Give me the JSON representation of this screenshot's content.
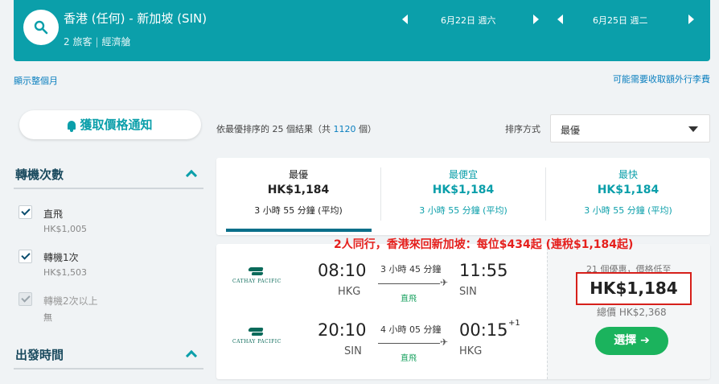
{
  "header": {
    "route": "香港 (任何) - 新加坡 (SIN)",
    "passengers": "2 旅客",
    "cabin": "經濟艙",
    "depart_date": "6月22日 週六",
    "return_date": "6月25日 週二"
  },
  "links": {
    "show_month": "顯示整個月",
    "baggage_fees": "可能需要收取額外行李費"
  },
  "price_alert": {
    "label": "獲取價格通知"
  },
  "filters": {
    "stops": {
      "title": "轉機次數",
      "options": [
        {
          "label": "直飛",
          "price": "HK$1,005",
          "checked": true
        },
        {
          "label": "轉機1次",
          "price": "HK$1,503",
          "checked": true
        },
        {
          "label": "轉機2次以上",
          "price": "無",
          "checked": true,
          "disabled": true
        }
      ]
    },
    "departure": {
      "title": "出發時間"
    }
  },
  "results": {
    "prefix": "依最優排序的 25 個結果（共 ",
    "total": "1120",
    "suffix": " 個）",
    "sort_label": "排序方式",
    "sort_value": "最優"
  },
  "sort_tabs": [
    {
      "title": "最優",
      "price": "HK$1,184",
      "duration": "3 小時 55 分鐘 (平均)"
    },
    {
      "title": "最便宜",
      "price": "HK$1,184",
      "duration": "3 小時 55 分鐘 (平均)"
    },
    {
      "title": "最快",
      "price": "HK$1,184",
      "duration": "3 小時 55 分鐘 (平均)"
    }
  ],
  "promo": "2人同行，香港來回新加坡：每位$434起 (連稅$1,184起)",
  "flight": {
    "airline": "CATHAY PACIFIC",
    "outbound": {
      "depart_time": "08:10",
      "depart_airport": "HKG",
      "duration": "3 小時 45 分鐘",
      "stops": "直飛",
      "arrive_time": "11:55",
      "arrive_airport": "SIN"
    },
    "inbound": {
      "depart_time": "20:10",
      "depart_airport": "SIN",
      "duration": "4 小時 05 分鐘",
      "stops": "直飛",
      "arrive_time": "00:15",
      "day_offset": "+1",
      "arrive_airport": "HKG"
    },
    "deals_text": "21 個優惠，價格低至",
    "price": "HK$1,184",
    "total": "總價 HK$2,368",
    "select_label": "選擇"
  },
  "colors": {
    "brand": "#0b9faa",
    "select": "#1bb35d",
    "promo": "#e5201d"
  }
}
